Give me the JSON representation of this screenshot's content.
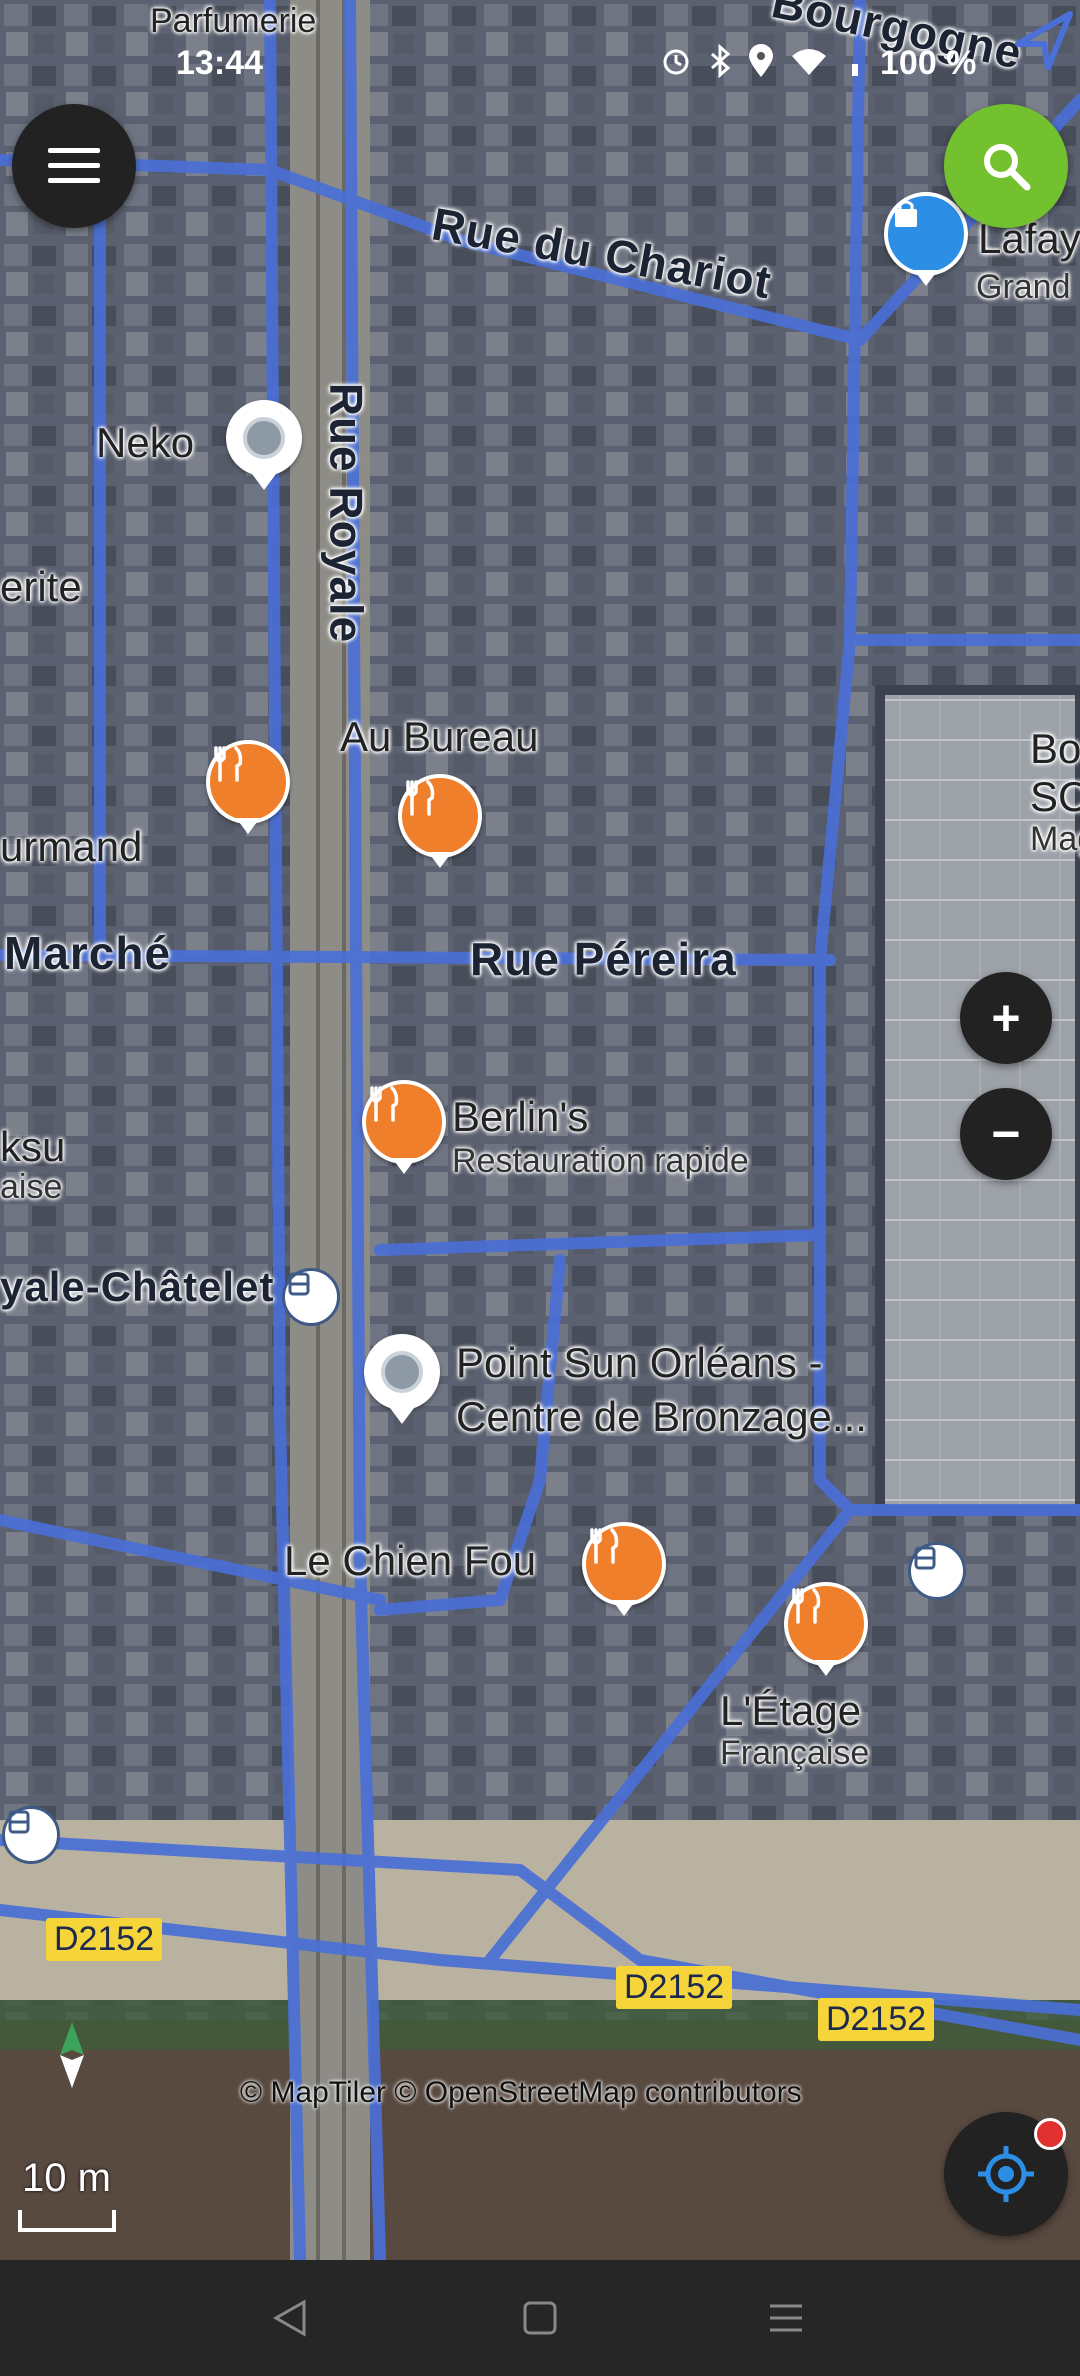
{
  "status_bar": {
    "time": "13:44",
    "battery": "100 %",
    "icons": [
      "alarm-icon",
      "bluetooth-icon",
      "location-icon",
      "wifi-icon",
      "signal-icon"
    ]
  },
  "map": {
    "streets": {
      "rue_du_chariot": "Rue du Chariot",
      "rue_royale": "Rue Royale",
      "rue_pereira": "Rue Péreira",
      "marche": "Marché",
      "bourgogne": "Bourgogne",
      "royale_chatelet": "yale-Châtelet",
      "parfumerie": "Parfumerie",
      "erite": "erite",
      "urmand": "urmand",
      "ksu": "ksu",
      "aise": "aise"
    },
    "pois": {
      "neko": "Neko",
      "au_bureau": "Au Bureau",
      "berlins": "Berlin's",
      "berlins_sub": "Restauration rapide",
      "point_sun": "Point Sun Orléans -",
      "point_sun_2": "Centre de Bronzage...",
      "chien_fou": "Le Chien Fou",
      "etage": "L'Étage",
      "etage_sub": "Française",
      "lafay": "Lafay",
      "grand": "Grand",
      "bout": "Bout",
      "sco": "SCO",
      "maga": "Maga"
    },
    "road_signs": [
      "D2152",
      "D2152",
      "D2152"
    ],
    "attribution": "© MapTiler © OpenStreetMap contributors",
    "scale": "10 m",
    "colors": {
      "road": "#4a6fd6",
      "food_marker": "#f07f2c",
      "search": "#74c12f"
    }
  },
  "controls": {
    "zoom_in": "+",
    "zoom_out": "−"
  }
}
